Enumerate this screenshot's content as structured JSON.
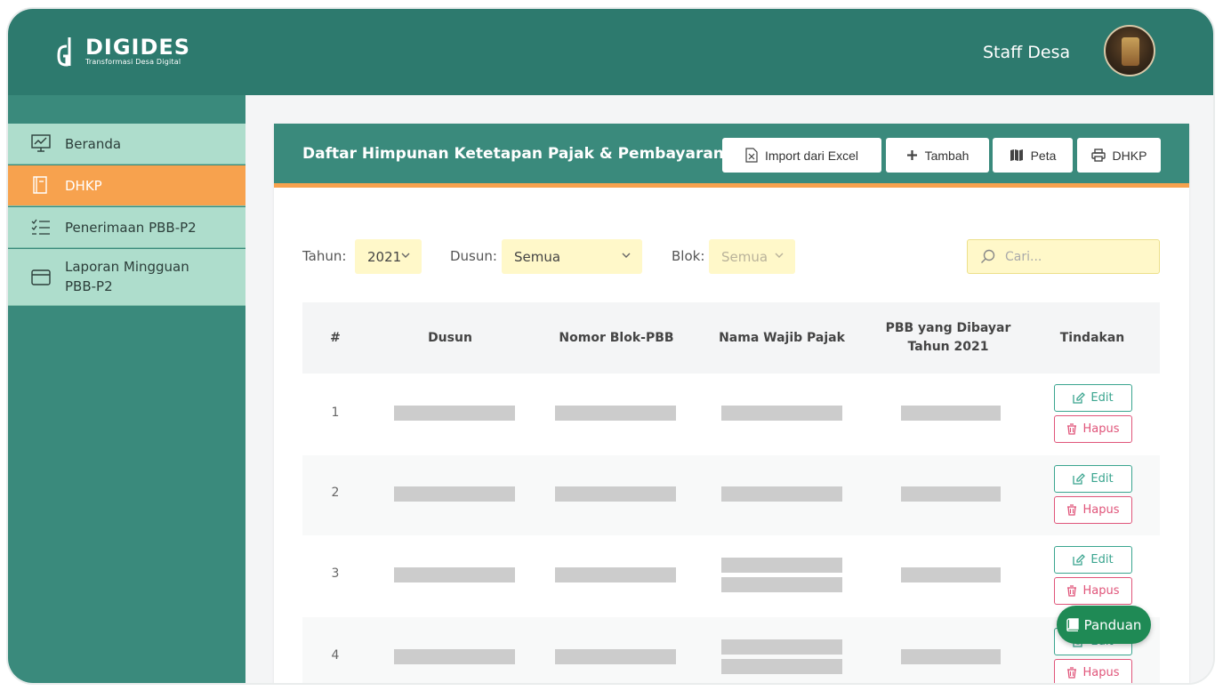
{
  "header": {
    "app_name": "DIGIDES",
    "tagline": "Transformasi Desa Digital",
    "user_name": "Staff Desa"
  },
  "sidebar": {
    "items": [
      {
        "label": "Beranda",
        "icon": "chart-icon",
        "active": false
      },
      {
        "label": "DHKP",
        "icon": "folder-icon",
        "active": true
      },
      {
        "label": "Penerimaan PBB-P2",
        "icon": "checklist-icon",
        "active": false
      },
      {
        "label": "Laporan Mingguan",
        "label2": "PBB-P2",
        "icon": "inbox-icon",
        "active": false
      }
    ]
  },
  "card": {
    "title": "Daftar Himpunan Ketetapan Pajak & Pembayaran",
    "buttons": {
      "import": "Import dari Excel",
      "add": "Tambah",
      "map": "Peta",
      "print": "DHKP"
    }
  },
  "filters": {
    "year_label": "Tahun:",
    "year_value": "2021",
    "dusun_label": "Dusun:",
    "dusun_value": "Semua",
    "blok_label": "Blok:",
    "blok_value": "Semua",
    "search_placeholder": "Cari..."
  },
  "table": {
    "columns": [
      "#",
      "Dusun",
      "Nomor Blok-PBB",
      "Nama Wajib Pajak",
      "PBB yang Dibayar",
      "Tahun 2021",
      "Tindakan"
    ],
    "rows": [
      {
        "no": "1",
        "name_lines": 1
      },
      {
        "no": "2",
        "name_lines": 1
      },
      {
        "no": "3",
        "name_lines": 2
      },
      {
        "no": "4",
        "name_lines": 2
      }
    ],
    "edit_label": "Edit",
    "delete_label": "Hapus"
  },
  "help_button": "Panduan",
  "colors": {
    "primary": "#2d7a6e",
    "accent": "#f7a24e",
    "sidebar_item": "#aeddcc",
    "filter_bg": "#fff8c9",
    "edit": "#3aa58f",
    "delete": "#e0557a",
    "help": "#1f8a55"
  }
}
